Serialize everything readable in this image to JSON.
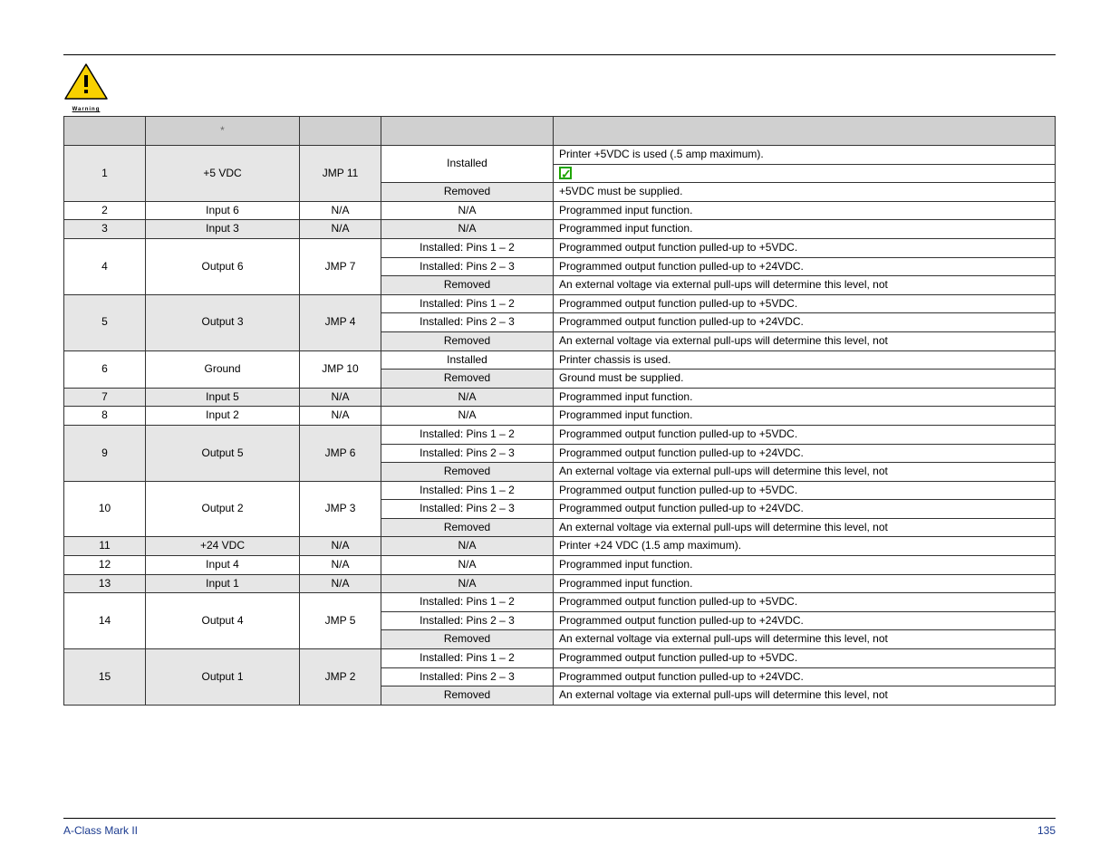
{
  "warning_label": "Warning",
  "rows": [
    {
      "pin": "1",
      "signal": "+5 VDC",
      "jumper": "JMP 11",
      "states": [
        {
          "pos": "Installed",
          "desc": "Printer +5VDC is used (.5 amp maximum).",
          "check": true
        },
        {
          "pos": "Removed",
          "desc": "+5VDC must be supplied."
        }
      ]
    },
    {
      "pin": "2",
      "signal": "Input 6",
      "jumper": "N/A",
      "states": [
        {
          "pos": "N/A",
          "desc": "Programmed input function."
        }
      ]
    },
    {
      "pin": "3",
      "signal": "Input 3",
      "jumper": "N/A",
      "states": [
        {
          "pos": "N/A",
          "desc": "Programmed input function."
        }
      ]
    },
    {
      "pin": "4",
      "signal": "Output 6",
      "jumper": "JMP 7",
      "states": [
        {
          "pos": "Installed: Pins 1 – 2",
          "desc": "Programmed output function pulled-up to +5VDC."
        },
        {
          "pos": "Installed: Pins 2 – 3",
          "desc": "Programmed output function pulled-up to +24VDC."
        },
        {
          "pos": "Removed",
          "desc": "An external voltage via external pull-ups will determine this level, not"
        }
      ]
    },
    {
      "pin": "5",
      "signal": "Output 3",
      "jumper": "JMP 4",
      "states": [
        {
          "pos": "Installed: Pins 1 – 2",
          "desc": "Programmed output function pulled-up to +5VDC."
        },
        {
          "pos": "Installed: Pins 2 – 3",
          "desc": "Programmed output function pulled-up to +24VDC."
        },
        {
          "pos": "Removed",
          "desc": "An external voltage via external pull-ups will determine this level, not"
        }
      ]
    },
    {
      "pin": "6",
      "signal": "Ground",
      "jumper": "JMP 10",
      "states": [
        {
          "pos": "Installed",
          "desc": "Printer chassis is used."
        },
        {
          "pos": "Removed",
          "desc": "Ground must be supplied."
        }
      ]
    },
    {
      "pin": "7",
      "signal": "Input 5",
      "jumper": "N/A",
      "states": [
        {
          "pos": "N/A",
          "desc": "Programmed input function."
        }
      ]
    },
    {
      "pin": "8",
      "signal": "Input 2",
      "jumper": "N/A",
      "states": [
        {
          "pos": "N/A",
          "desc": "Programmed input function."
        }
      ]
    },
    {
      "pin": "9",
      "signal": "Output 5",
      "jumper": "JMP 6",
      "states": [
        {
          "pos": "Installed: Pins 1 – 2",
          "desc": "Programmed output function pulled-up to +5VDC."
        },
        {
          "pos": "Installed: Pins 2 – 3",
          "desc": "Programmed output function pulled-up to +24VDC."
        },
        {
          "pos": "Removed",
          "desc": "An external voltage via external pull-ups will determine this level, not"
        }
      ]
    },
    {
      "pin": "10",
      "signal": "Output 2",
      "jumper": "JMP 3",
      "states": [
        {
          "pos": "Installed: Pins 1 – 2",
          "desc": "Programmed output function pulled-up to +5VDC."
        },
        {
          "pos": "Installed: Pins 2 – 3",
          "desc": "Programmed output function pulled-up to +24VDC."
        },
        {
          "pos": "Removed",
          "desc": "An external voltage via external pull-ups will determine this level, not"
        }
      ]
    },
    {
      "pin": "11",
      "signal": "+24 VDC",
      "jumper": "N/A",
      "states": [
        {
          "pos": "N/A",
          "desc": "Printer +24 VDC (1.5 amp maximum)."
        }
      ]
    },
    {
      "pin": "12",
      "signal": "Input 4",
      "jumper": "N/A",
      "states": [
        {
          "pos": "N/A",
          "desc": "Programmed input function."
        }
      ]
    },
    {
      "pin": "13",
      "signal": "Input 1",
      "jumper": "N/A",
      "states": [
        {
          "pos": "N/A",
          "desc": "Programmed input function."
        }
      ]
    },
    {
      "pin": "14",
      "signal": "Output 4",
      "jumper": "JMP 5",
      "states": [
        {
          "pos": "Installed: Pins 1 – 2",
          "desc": "Programmed output function pulled-up to +5VDC."
        },
        {
          "pos": "Installed: Pins 2 – 3",
          "desc": "Programmed output function pulled-up to +24VDC."
        },
        {
          "pos": "Removed",
          "desc": "An external voltage via external pull-ups will determine this level, not"
        }
      ]
    },
    {
      "pin": "15",
      "signal": "Output 1",
      "jumper": "JMP 2",
      "states": [
        {
          "pos": "Installed: Pins 1 – 2",
          "desc": "Programmed output function pulled-up to +5VDC."
        },
        {
          "pos": "Installed: Pins 2 – 3",
          "desc": "Programmed output function pulled-up to +24VDC."
        },
        {
          "pos": "Removed",
          "desc": "An external voltage via external pull-ups will determine this level, not"
        }
      ]
    }
  ],
  "footer_left": "A-Class Mark II",
  "footer_right": "135",
  "header_star": "*"
}
